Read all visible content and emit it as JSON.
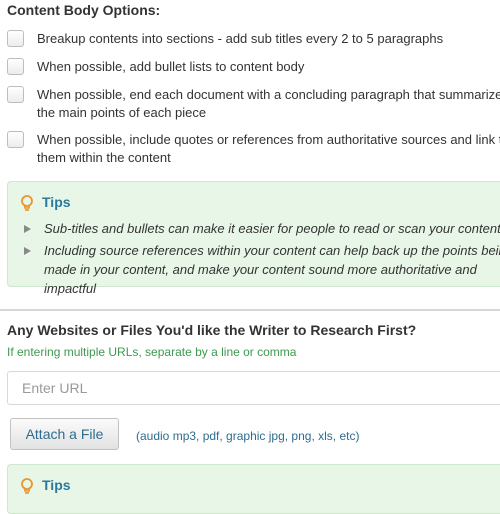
{
  "content_body": {
    "title": "Content Body Options:",
    "options": [
      {
        "label": "Breakup contents into sections - add sub titles every 2 to 5 paragraphs"
      },
      {
        "label": "When possible, add bullet lists to content body"
      },
      {
        "label": "When possible, end each document with a concluding paragraph that summarizes the main points of each piece"
      },
      {
        "label": "When possible, include quotes or references from authoritative sources and link to them within the content"
      }
    ]
  },
  "tips_1": {
    "title": "Tips",
    "items": [
      "Sub-titles and bullets can make it easier for people to read or scan your content",
      "Including source references within your content can help back up the points being made in your content, and make your content sound more authoritative and impactful"
    ]
  },
  "research": {
    "title": "Any Websites or Files You'd like the Writer to Research First?",
    "hint": "If entering multiple URLs, separate by a line or comma",
    "url_placeholder": "Enter URL",
    "attach_label": "Attach a File",
    "file_types": "(audio mp3, pdf, graphic jpg, png, xls, etc)"
  },
  "tips_2": {
    "title": "Tips"
  },
  "colors": {
    "tips_background": "#e7f6e6",
    "tips_title": "#2b7a9e",
    "hint_green": "#3c9a4f",
    "bulb_orange": "#e8962e",
    "link_blue": "#2d6d8f"
  },
  "icons": {
    "tips": "lightbulb-icon",
    "tip_bullet": "triangle-bullet-icon"
  }
}
